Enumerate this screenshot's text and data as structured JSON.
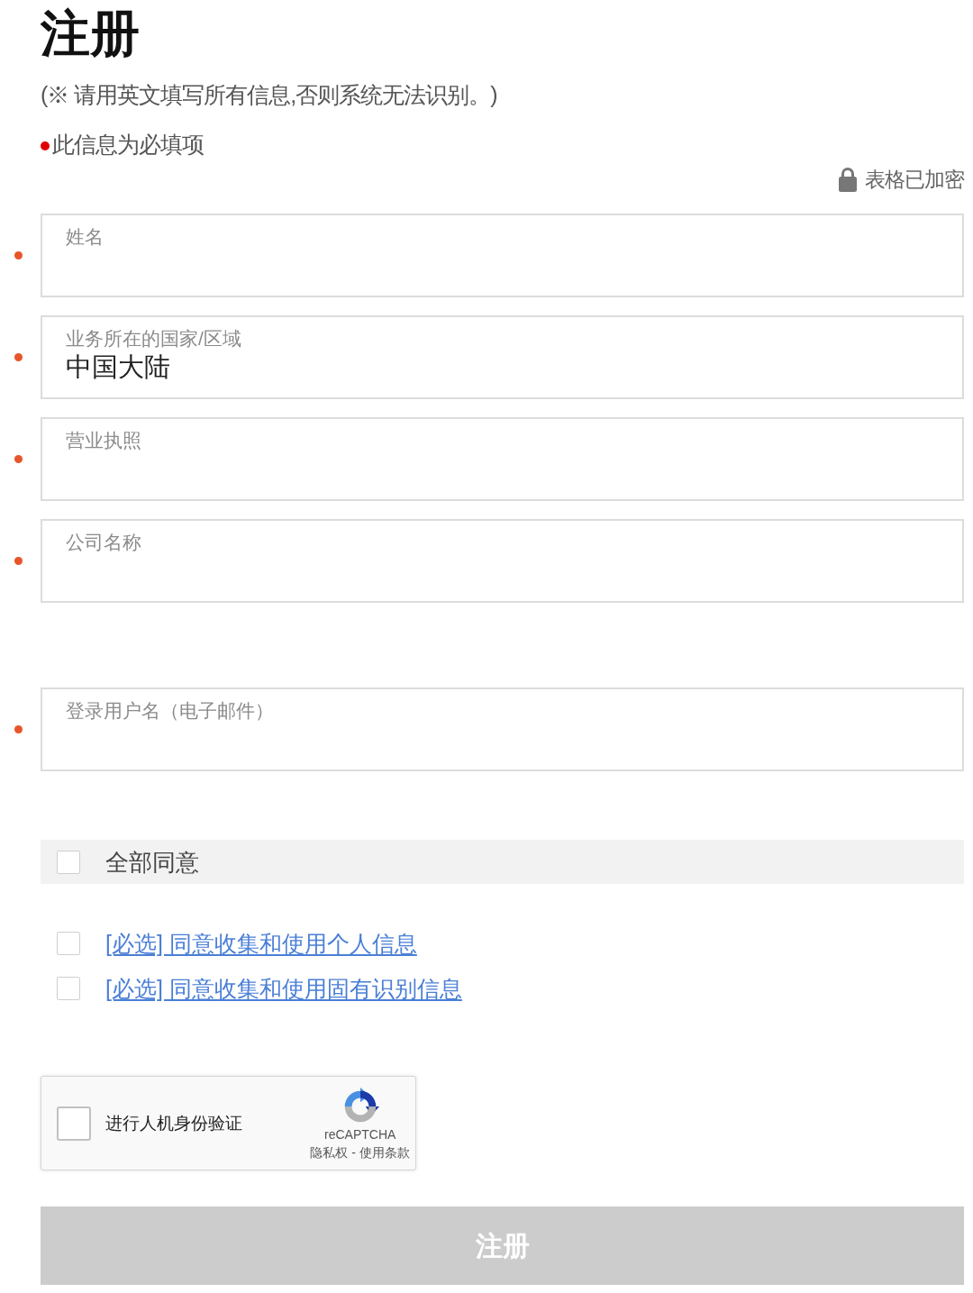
{
  "title": "注册",
  "notice": "(※ 请用英文填写所有信息,否则系统无法识别。)",
  "required_notice": "此信息为必填项",
  "encryption": {
    "label": "表格已加密"
  },
  "sections": [
    {
      "fields": [
        {
          "label": "姓名",
          "required": true
        },
        {
          "label": "业务所在的国家/区域",
          "value": "中国大陆",
          "required": true
        },
        {
          "label": "营业执照",
          "required": true
        },
        {
          "label": "公司名称",
          "required": true
        }
      ]
    },
    {
      "fields": [
        {
          "label": "登录用户名（电子邮件）",
          "required": true
        }
      ]
    }
  ],
  "agree_all": {
    "label": "全部同意",
    "checked": false
  },
  "consents": [
    {
      "label": "[必选] 同意收集和使用个人信息",
      "checked": false
    },
    {
      "label": "[必选] 同意收集和使用固有识别信息",
      "checked": false
    }
  ],
  "captcha": {
    "label": "进行人机身份验证",
    "checked": false,
    "brand": "reCAPTCHA",
    "privacy_link": "隐私权",
    "separator": "-",
    "terms_link": "使用条款"
  },
  "submit": {
    "label": "注册",
    "disabled": true
  }
}
